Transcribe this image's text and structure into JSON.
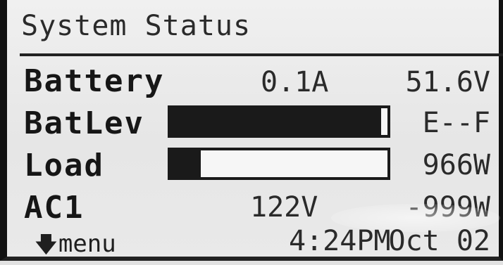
{
  "header": {
    "title": "System Status"
  },
  "rows": {
    "battery": {
      "label": "Battery",
      "current": "0.1A",
      "voltage": "51.6V"
    },
    "batlev": {
      "label": "BatLev",
      "level": 0.97,
      "scale": "E--F"
    },
    "load": {
      "label": "Load",
      "level": 0.14,
      "power": "966W"
    },
    "ac1": {
      "label": "AC1",
      "voltage": "122V",
      "power": "-999W"
    }
  },
  "footer": {
    "menu_label": "menu",
    "menu_icon": "down-arrow-icon",
    "time": "4:24PM",
    "date": "Oct 02"
  },
  "colors": {
    "screen": "#e6e6e6",
    "ink": "#1a1a1a"
  }
}
